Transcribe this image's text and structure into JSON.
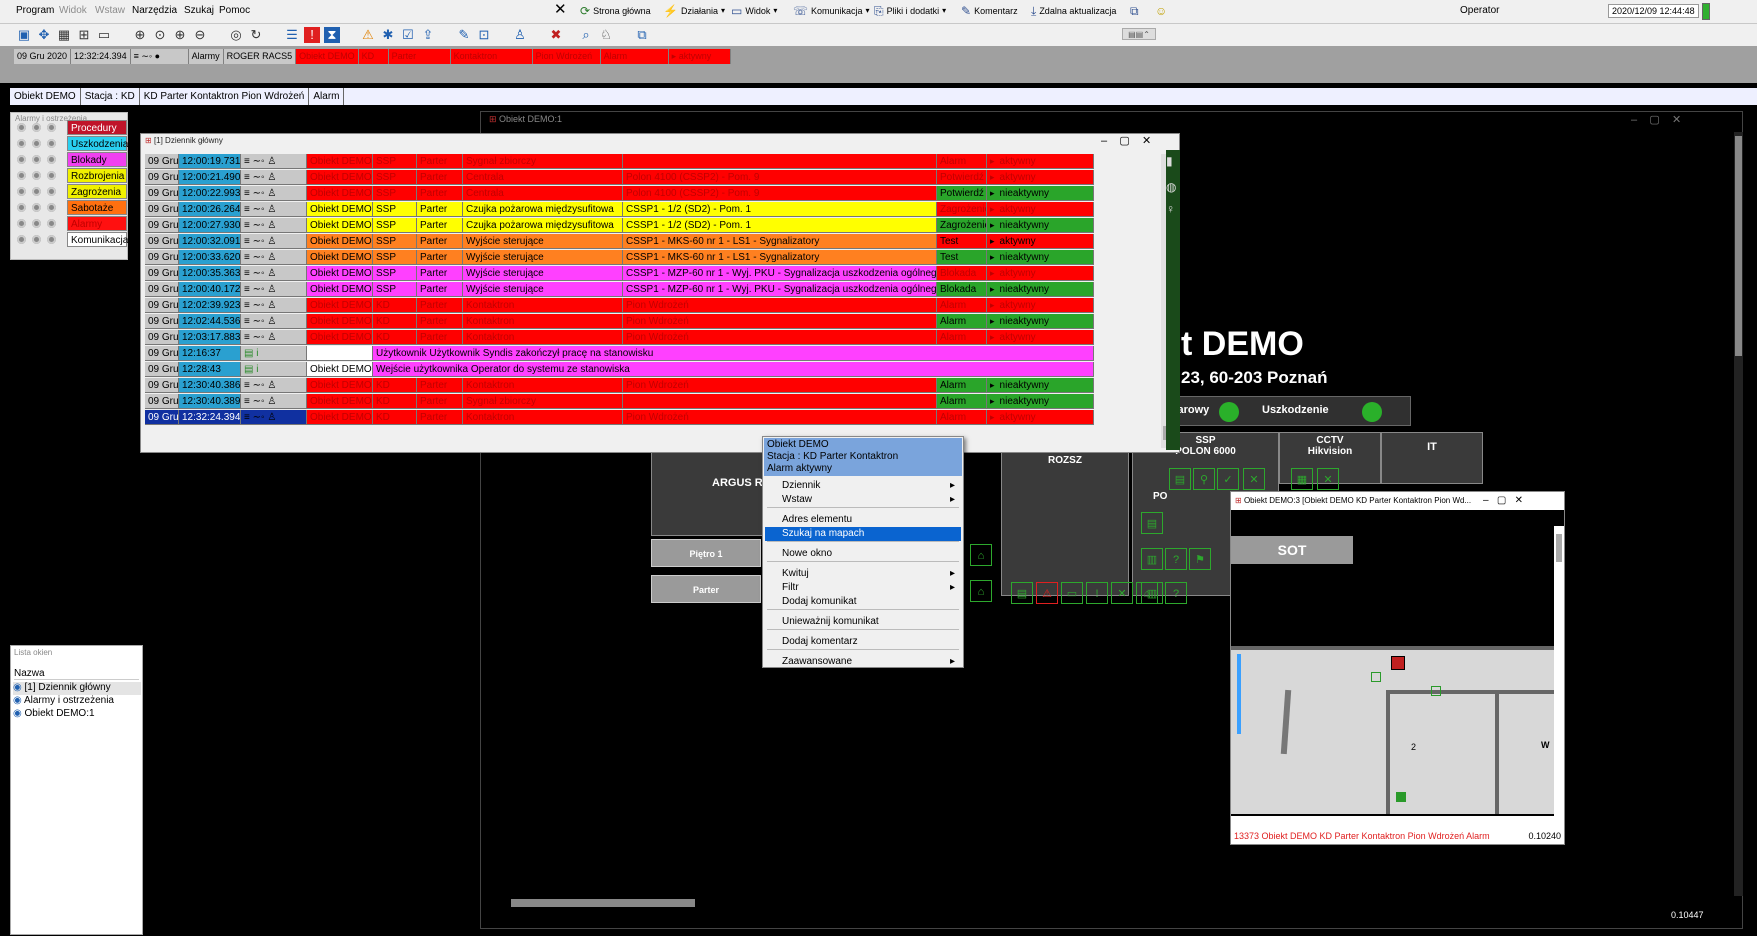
{
  "menubar": {
    "items": [
      "Program",
      "Widok",
      "Wstaw",
      "Narzędzia",
      "Szukaj",
      "Pomoc"
    ],
    "disabled": [
      false,
      true,
      true,
      false,
      false,
      false
    ],
    "toolbar": {
      "home": "Strona główna",
      "actions": "Działania",
      "view": "Widok",
      "comm": "Komunikacja",
      "files": "Pliki i dodatki",
      "comment": "Komentarz",
      "update": "Zdalna aktualizacja"
    },
    "operator": "Operator",
    "datetime": "2020/12/09 12:44:48"
  },
  "alarm_strip": {
    "date": "09 Gru 2020",
    "time": "12:32:24.394",
    "type": "Alarmy",
    "device": "ROGER RACS5",
    "object": "Obiekt DEMO",
    "system": "KD",
    "floor": "Parter",
    "element": "Kontaktron",
    "zone": "Pion Wdrożeń",
    "event": "Alarm",
    "state": "aktywny"
  },
  "breadcrumb": [
    "Obiekt DEMO",
    "Stacja : KD",
    "KD Parter Kontaktron Pion Wdrożeń",
    "Alarm"
  ],
  "legend": {
    "title": "Alarmy i ostrzeżenia",
    "items": [
      {
        "label": "Procedury",
        "bg": "#c0142a",
        "fg": "#ffffff"
      },
      {
        "label": "Uszkodzenia",
        "bg": "#29d0f0",
        "fg": "#000000"
      },
      {
        "label": "Blokady",
        "bg": "#f040f0",
        "fg": "#000000"
      },
      {
        "label": "Rozbrojenia",
        "bg": "#f0f000",
        "fg": "#000000"
      },
      {
        "label": "Zagrożenia",
        "bg": "#f0f000",
        "fg": "#000000"
      },
      {
        "label": "Sabotaże",
        "bg": "#ff7010",
        "fg": "#000000"
      },
      {
        "label": "Alarmy",
        "bg": "#ff1010",
        "fg": "#c00000"
      },
      {
        "label": "Komunikacja",
        "bg": "#ffffff",
        "fg": "#000000"
      }
    ]
  },
  "window_list": {
    "title": "Lista okien",
    "header": "Nazwa",
    "items": [
      "[1] Dziennik główny",
      "Alarmy i ostrzeżenia",
      "Obiekt DEMO:1"
    ]
  },
  "map_window": {
    "title": "Obiekt DEMO:1",
    "big_title": "t DEMO",
    "address": "23, 60-203 Poznań",
    "status_fire": "żarowy",
    "status_fault": "Uszkodzenie",
    "panels": [
      "SSP\nPOLON 6000",
      "CCTV\nHikvision",
      "IT"
    ],
    "argus": "ARGUS R",
    "rozsz": "ROZSZ",
    "po": "PO",
    "pietro1": "Piętro 1",
    "parter": "Parter",
    "zoom": "0.10447"
  },
  "journal": {
    "title": "[1] Dziennik główny",
    "rows": [
      {
        "d": "09 Gru",
        "t": "12:00:19.731",
        "o": "Obiekt DEMO",
        "s": "SSP",
        "f": "Parter",
        "e": "Sygnał zbiorczy",
        "z": "",
        "ev": "Alarm",
        "st": "aktywny",
        "bg": "#ff0000",
        "fg": "#c00000",
        "evbg": "#ff0000",
        "evfg": "#c00000"
      },
      {
        "d": "09 Gru",
        "t": "12:00:21.490",
        "o": "Obiekt DEMO",
        "s": "SSP",
        "f": "Parter",
        "e": "Centrala",
        "z": "Polon 4100 (CSSP2) - Pom. 9",
        "ev": "Potwierdź",
        "st": "aktywny",
        "bg": "#ff0000",
        "fg": "#c00000",
        "evbg": "#ff0000",
        "evfg": "#c00000"
      },
      {
        "d": "09 Gru",
        "t": "12:00:22.993",
        "o": "Obiekt DEMO",
        "s": "SSP",
        "f": "Parter",
        "e": "Centrala",
        "z": "Polon 4100 (CSSP2) - Pom. 9",
        "ev": "Potwierdź",
        "st": "nieaktywny",
        "bg": "#ff0000",
        "fg": "#c00000",
        "evbg": "#2aa52a",
        "evfg": "#000000"
      },
      {
        "d": "09 Gru",
        "t": "12:00:26.264",
        "o": "Obiekt DEMO",
        "s": "SSP",
        "f": "Parter",
        "e": "Czujka pożarowa międzysufitowa",
        "z": "CSSP1 - 1/2 (SD2) - Pom. 1",
        "ev": "Zagrożenie",
        "st": "aktywny",
        "bg": "#ffff00",
        "fg": "#000000",
        "evbg": "#ff0000",
        "evfg": "#c00000"
      },
      {
        "d": "09 Gru",
        "t": "12:00:27.930",
        "o": "Obiekt DEMO",
        "s": "SSP",
        "f": "Parter",
        "e": "Czujka pożarowa międzysufitowa",
        "z": "CSSP1 - 1/2 (SD2) - Pom. 1",
        "ev": "Zagrożenie",
        "st": "nieaktywny",
        "bg": "#ffff00",
        "fg": "#000000",
        "evbg": "#2aa52a",
        "evfg": "#000000"
      },
      {
        "d": "09 Gru",
        "t": "12:00:32.091",
        "o": "Obiekt DEMO",
        "s": "SSP",
        "f": "Parter",
        "e": "Wyjście sterujące",
        "z": "CSSP1 - MKS-60 nr 1 - LS1 - Sygnalizatory",
        "ev": "Test",
        "st": "aktywny",
        "bg": "#ff8020",
        "fg": "#000000",
        "evbg": "#ff0000",
        "evfg": "#000000"
      },
      {
        "d": "09 Gru",
        "t": "12:00:33.620",
        "o": "Obiekt DEMO",
        "s": "SSP",
        "f": "Parter",
        "e": "Wyjście sterujące",
        "z": "CSSP1 - MKS-60 nr 1 - LS1 - Sygnalizatory",
        "ev": "Test",
        "st": "nieaktywny",
        "bg": "#ff8020",
        "fg": "#000000",
        "evbg": "#2aa52a",
        "evfg": "#000000"
      },
      {
        "d": "09 Gru",
        "t": "12:00:35.363",
        "o": "Obiekt DEMO",
        "s": "SSP",
        "f": "Parter",
        "e": "Wyjście sterujące",
        "z": "CSSP1 - MZP-60 nr 1 - Wyj. PKU - Sygnalizacja uszkodzenia ogólnego",
        "ev": "Blokada",
        "st": "aktywny",
        "bg": "#ff40ff",
        "fg": "#000000",
        "evbg": "#ff0000",
        "evfg": "#c00000"
      },
      {
        "d": "09 Gru",
        "t": "12:00:40.172",
        "o": "Obiekt DEMO",
        "s": "SSP",
        "f": "Parter",
        "e": "Wyjście sterujące",
        "z": "CSSP1 - MZP-60 nr 1 - Wyj. PKU - Sygnalizacja uszkodzenia ogólnego",
        "ev": "Blokada",
        "st": "nieaktywny",
        "bg": "#ff40ff",
        "fg": "#000000",
        "evbg": "#2aa52a",
        "evfg": "#000000"
      },
      {
        "d": "09 Gru",
        "t": "12:02:39.923",
        "o": "Obiekt DEMO",
        "s": "KD",
        "f": "Parter",
        "e": "Kontaktron",
        "z": "Pion Wdrożeń",
        "ev": "Alarm",
        "st": "aktywny",
        "bg": "#ff0000",
        "fg": "#c00000",
        "evbg": "#ff0000",
        "evfg": "#c00000"
      },
      {
        "d": "09 Gru",
        "t": "12:02:44.536",
        "o": "Obiekt DEMO",
        "s": "KD",
        "f": "Parter",
        "e": "Kontaktron",
        "z": "Pion Wdrożeń",
        "ev": "Alarm",
        "st": "nieaktywny",
        "bg": "#ff0000",
        "fg": "#c00000",
        "evbg": "#2aa52a",
        "evfg": "#000000"
      },
      {
        "d": "09 Gru",
        "t": "12:03:17.883",
        "o": "Obiekt DEMO",
        "s": "KD",
        "f": "Parter",
        "e": "Kontaktron",
        "z": "Pion Wdrożeń",
        "ev": "Alarm",
        "st": "aktywny",
        "bg": "#ff0000",
        "fg": "#c00000",
        "evbg": "#ff0000",
        "evfg": "#c00000"
      }
    ],
    "msg_rows": [
      {
        "d": "09 Gru",
        "t": "12:16:37",
        "o": "",
        "msg": "Użytkownik Użytkownik Syndis zakończył pracę na stanowisku"
      },
      {
        "d": "09 Gru",
        "t": "12:28:43",
        "o": "Obiekt DEMO",
        "msg": "Wejście użytkownika Operator do systemu ze stanowiska"
      }
    ],
    "tail_rows": [
      {
        "d": "09 Gru",
        "t": "12:30:40.386",
        "o": "Obiekt DEMO",
        "s": "KD",
        "f": "Parter",
        "e": "Kontaktron",
        "z": "Pion Wdrożeń",
        "ev": "Alarm",
        "st": "nieaktywny",
        "bg": "#ff0000",
        "fg": "#c00000",
        "evbg": "#2aa52a",
        "evfg": "#000000"
      },
      {
        "d": "09 Gru",
        "t": "12:30:40.389",
        "o": "Obiekt DEMO",
        "s": "KD",
        "f": "Parter",
        "e": "Sygnał zbiorczy",
        "z": "",
        "ev": "Alarm",
        "st": "nieaktywny",
        "bg": "#ff0000",
        "fg": "#c00000",
        "evbg": "#2aa52a",
        "evfg": "#000000"
      },
      {
        "d": "09 Gru",
        "t": "12:32:24.394",
        "o": "Obiekt DEMO",
        "s": "KD",
        "f": "Parter",
        "e": "Kontaktron",
        "z": "Pion Wdrożeń",
        "ev": "Alarm",
        "st": "aktywny",
        "bg": "#ff0000",
        "fg": "#c00000",
        "evbg": "#ff0000",
        "evfg": "#c00000"
      }
    ]
  },
  "context_menu": {
    "header": [
      "Obiekt DEMO",
      "Stacja : KD Parter Kontaktron",
      "Alarm aktywny"
    ],
    "items": [
      {
        "label": "Dziennik",
        "sub": true
      },
      {
        "label": "Wstaw",
        "sub": true
      },
      {
        "label": "Adres elementu",
        "sub": false
      },
      {
        "label": "Szukaj na mapach",
        "sub": false,
        "hl": true
      },
      {
        "label": "Nowe okno",
        "sub": false
      },
      {
        "label": "Kwituj",
        "sub": true
      },
      {
        "label": "Filtr",
        "sub": true
      },
      {
        "label": "Dodaj komunikat",
        "sub": false
      },
      {
        "label": "Unieważnij komunikat",
        "sub": false
      },
      {
        "label": "Dodaj komentarz",
        "sub": false
      },
      {
        "label": "Zaawansowane",
        "sub": true
      }
    ]
  },
  "sub_window": {
    "title": "Obiekt DEMO:3 [Obiekt DEMO KD Parter Kontaktron Pion Wd...",
    "sot": "SOT",
    "status": "13373 Obiekt DEMO KD Parter Kontaktron Pion Wdrożeń Alarm",
    "zoom": "0.10240",
    "room": "2",
    "w": "W"
  }
}
